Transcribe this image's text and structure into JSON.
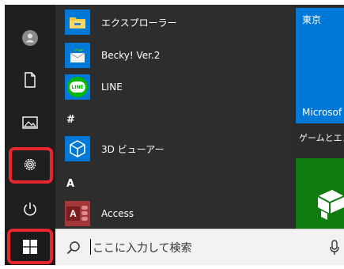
{
  "app_list": {
    "items": [
      {
        "label": "エクスプローラー",
        "icon": "file-explorer-icon"
      },
      {
        "label": "Becky! Ver.2",
        "icon": "becky-mail-icon"
      },
      {
        "label": "LINE",
        "icon": "line-icon"
      },
      {
        "label": "3D ビューアー",
        "icon": "3d-viewer-icon"
      },
      {
        "label": "Access",
        "icon": "access-icon"
      }
    ],
    "groups": [
      "#",
      "A"
    ]
  },
  "tiles": {
    "weather_title": "東京",
    "weather_bottom": "Microsof",
    "group_label": "ゲームとエン"
  },
  "icons": {
    "line_text": "LINE",
    "access_letter": "A"
  },
  "taskbar": {
    "search_placeholder": "ここに入力して検索"
  },
  "colors": {
    "accent_blue": "#0078d7",
    "highlight_red": "#e8262d",
    "xbox_green": "#107c10"
  }
}
